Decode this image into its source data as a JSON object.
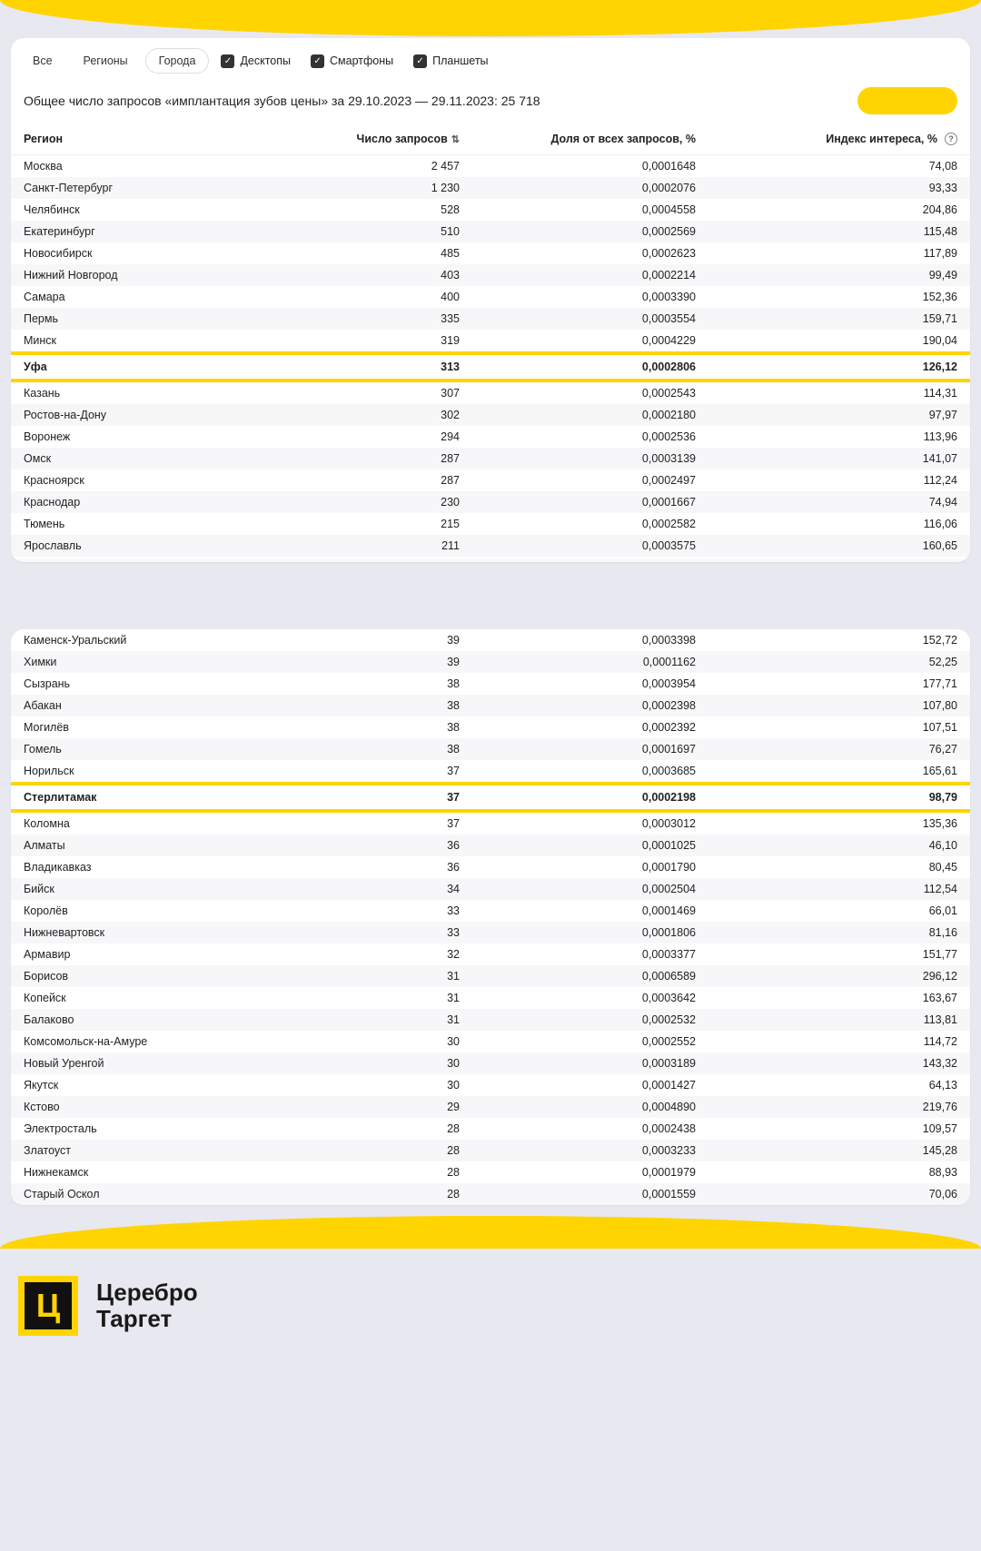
{
  "tabs": {
    "all": "Все",
    "regions": "Регионы",
    "cities": "Города",
    "desktops": "Десктопы",
    "smartphones": "Смартфоны",
    "tablets": "Планшеты"
  },
  "summary": "Общее число запросов «имплантация зубов цены» за 29.10.2023 — 29.11.2023: 25 718",
  "columns": {
    "region": "Регион",
    "requests": "Число запросов",
    "share": "Доля от всех запросов, %",
    "index": "Индекс интереса, %"
  },
  "table1": [
    {
      "region": "Москва",
      "req": "2 457",
      "share": "0,0001648",
      "idx": "74,08"
    },
    {
      "region": "Санкт-Петербург",
      "req": "1 230",
      "share": "0,0002076",
      "idx": "93,33"
    },
    {
      "region": "Челябинск",
      "req": "528",
      "share": "0,0004558",
      "idx": "204,86"
    },
    {
      "region": "Екатеринбург",
      "req": "510",
      "share": "0,0002569",
      "idx": "115,48"
    },
    {
      "region": "Новосибирск",
      "req": "485",
      "share": "0,0002623",
      "idx": "117,89"
    },
    {
      "region": "Нижний Новгород",
      "req": "403",
      "share": "0,0002214",
      "idx": "99,49"
    },
    {
      "region": "Самара",
      "req": "400",
      "share": "0,0003390",
      "idx": "152,36"
    },
    {
      "region": "Пермь",
      "req": "335",
      "share": "0,0003554",
      "idx": "159,71"
    },
    {
      "region": "Минск",
      "req": "319",
      "share": "0,0004229",
      "idx": "190,04"
    },
    {
      "region": "Уфа",
      "req": "313",
      "share": "0,0002806",
      "idx": "126,12",
      "hl": true
    },
    {
      "region": "Казань",
      "req": "307",
      "share": "0,0002543",
      "idx": "114,31"
    },
    {
      "region": "Ростов-на-Дону",
      "req": "302",
      "share": "0,0002180",
      "idx": "97,97"
    },
    {
      "region": "Воронеж",
      "req": "294",
      "share": "0,0002536",
      "idx": "113,96"
    },
    {
      "region": "Омск",
      "req": "287",
      "share": "0,0003139",
      "idx": "141,07"
    },
    {
      "region": "Красноярск",
      "req": "287",
      "share": "0,0002497",
      "idx": "112,24"
    },
    {
      "region": "Краснодар",
      "req": "230",
      "share": "0,0001667",
      "idx": "74,94"
    },
    {
      "region": "Тюмень",
      "req": "215",
      "share": "0,0002582",
      "idx": "116,06"
    },
    {
      "region": "Ярославль",
      "req": "211",
      "share": "0,0003575",
      "idx": "160,65"
    }
  ],
  "table2": [
    {
      "region": "Каменск-Уральский",
      "req": "39",
      "share": "0,0003398",
      "idx": "152,72"
    },
    {
      "region": "Химки",
      "req": "39",
      "share": "0,0001162",
      "idx": "52,25"
    },
    {
      "region": "Сызрань",
      "req": "38",
      "share": "0,0003954",
      "idx": "177,71"
    },
    {
      "region": "Абакан",
      "req": "38",
      "share": "0,0002398",
      "idx": "107,80"
    },
    {
      "region": "Могилёв",
      "req": "38",
      "share": "0,0002392",
      "idx": "107,51"
    },
    {
      "region": "Гомель",
      "req": "38",
      "share": "0,0001697",
      "idx": "76,27"
    },
    {
      "region": "Норильск",
      "req": "37",
      "share": "0,0003685",
      "idx": "165,61"
    },
    {
      "region": "Стерлитамак",
      "req": "37",
      "share": "0,0002198",
      "idx": "98,79",
      "hl": true
    },
    {
      "region": "Коломна",
      "req": "37",
      "share": "0,0003012",
      "idx": "135,36"
    },
    {
      "region": "Алматы",
      "req": "36",
      "share": "0,0001025",
      "idx": "46,10"
    },
    {
      "region": "Владикавказ",
      "req": "36",
      "share": "0,0001790",
      "idx": "80,45"
    },
    {
      "region": "Бийск",
      "req": "34",
      "share": "0,0002504",
      "idx": "112,54"
    },
    {
      "region": "Королёв",
      "req": "33",
      "share": "0,0001469",
      "idx": "66,01"
    },
    {
      "region": "Нижневартовск",
      "req": "33",
      "share": "0,0001806",
      "idx": "81,16"
    },
    {
      "region": "Армавир",
      "req": "32",
      "share": "0,0003377",
      "idx": "151,77"
    },
    {
      "region": "Борисов",
      "req": "31",
      "share": "0,0006589",
      "idx": "296,12"
    },
    {
      "region": "Копейск",
      "req": "31",
      "share": "0,0003642",
      "idx": "163,67"
    },
    {
      "region": "Балаково",
      "req": "31",
      "share": "0,0002532",
      "idx": "113,81"
    },
    {
      "region": "Комсомольск-на-Амуре",
      "req": "30",
      "share": "0,0002552",
      "idx": "114,72"
    },
    {
      "region": "Новый Уренгой",
      "req": "30",
      "share": "0,0003189",
      "idx": "143,32"
    },
    {
      "region": "Якутск",
      "req": "30",
      "share": "0,0001427",
      "idx": "64,13"
    },
    {
      "region": "Кстово",
      "req": "29",
      "share": "0,0004890",
      "idx": "219,76"
    },
    {
      "region": "Электросталь",
      "req": "28",
      "share": "0,0002438",
      "idx": "109,57"
    },
    {
      "region": "Златоуст",
      "req": "28",
      "share": "0,0003233",
      "idx": "145,28"
    },
    {
      "region": "Нижнекамск",
      "req": "28",
      "share": "0,0001979",
      "idx": "88,93"
    },
    {
      "region": "Старый Оскол",
      "req": "28",
      "share": "0,0001559",
      "idx": "70,06"
    }
  ],
  "brand": {
    "letter": "Ц",
    "line1": "Церебро",
    "line2": "Таргет"
  }
}
